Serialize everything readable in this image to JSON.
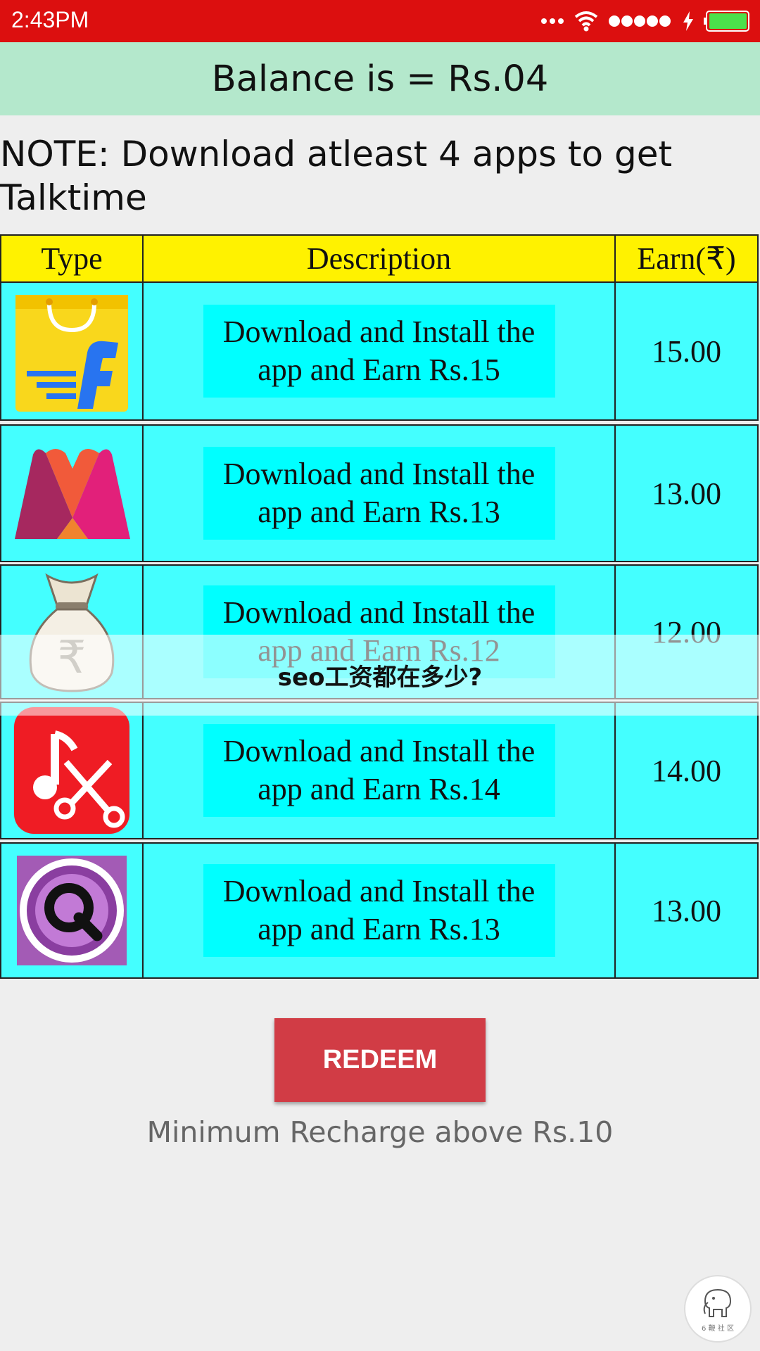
{
  "status_bar": {
    "time": "2:43PM"
  },
  "balance": {
    "text": "Balance is = Rs.04"
  },
  "note": {
    "text": "NOTE: Download atleast 4 apps to get Talktime"
  },
  "offers_table": {
    "headers": [
      "Type",
      "Description",
      "Earn(₹)"
    ],
    "rows": [
      {
        "icon": "flipkart-icon",
        "description": "Download and Install the app and Earn Rs.15",
        "earn": "15.00"
      },
      {
        "icon": "myntra-icon",
        "description": "Download and Install the app and Earn Rs.13",
        "earn": "13.00"
      },
      {
        "icon": "money-bag-icon",
        "description": "Download and Install the app and Earn Rs.12",
        "earn": "12.00"
      },
      {
        "icon": "music-cutter-icon",
        "description": "Download and Install the app and Earn Rs.14",
        "earn": "14.00"
      },
      {
        "icon": "quicktime-icon",
        "description": "Download and Install the app and Earn Rs.13",
        "earn": "13.00"
      }
    ]
  },
  "overlay_banner": {
    "text": "seo工资都在多少?"
  },
  "redeem": {
    "label": "REDEEM"
  },
  "min_recharge": {
    "text": "Minimum Recharge above Rs.10"
  },
  "watermark": {
    "text": "6 鞭 社 区"
  },
  "colors": {
    "status_bar": "#dc0f0f",
    "balance_bar": "#b4e8cc",
    "table_header": "#fff200",
    "table_row": "#44ffff",
    "redeem_button": "#d13c45"
  }
}
